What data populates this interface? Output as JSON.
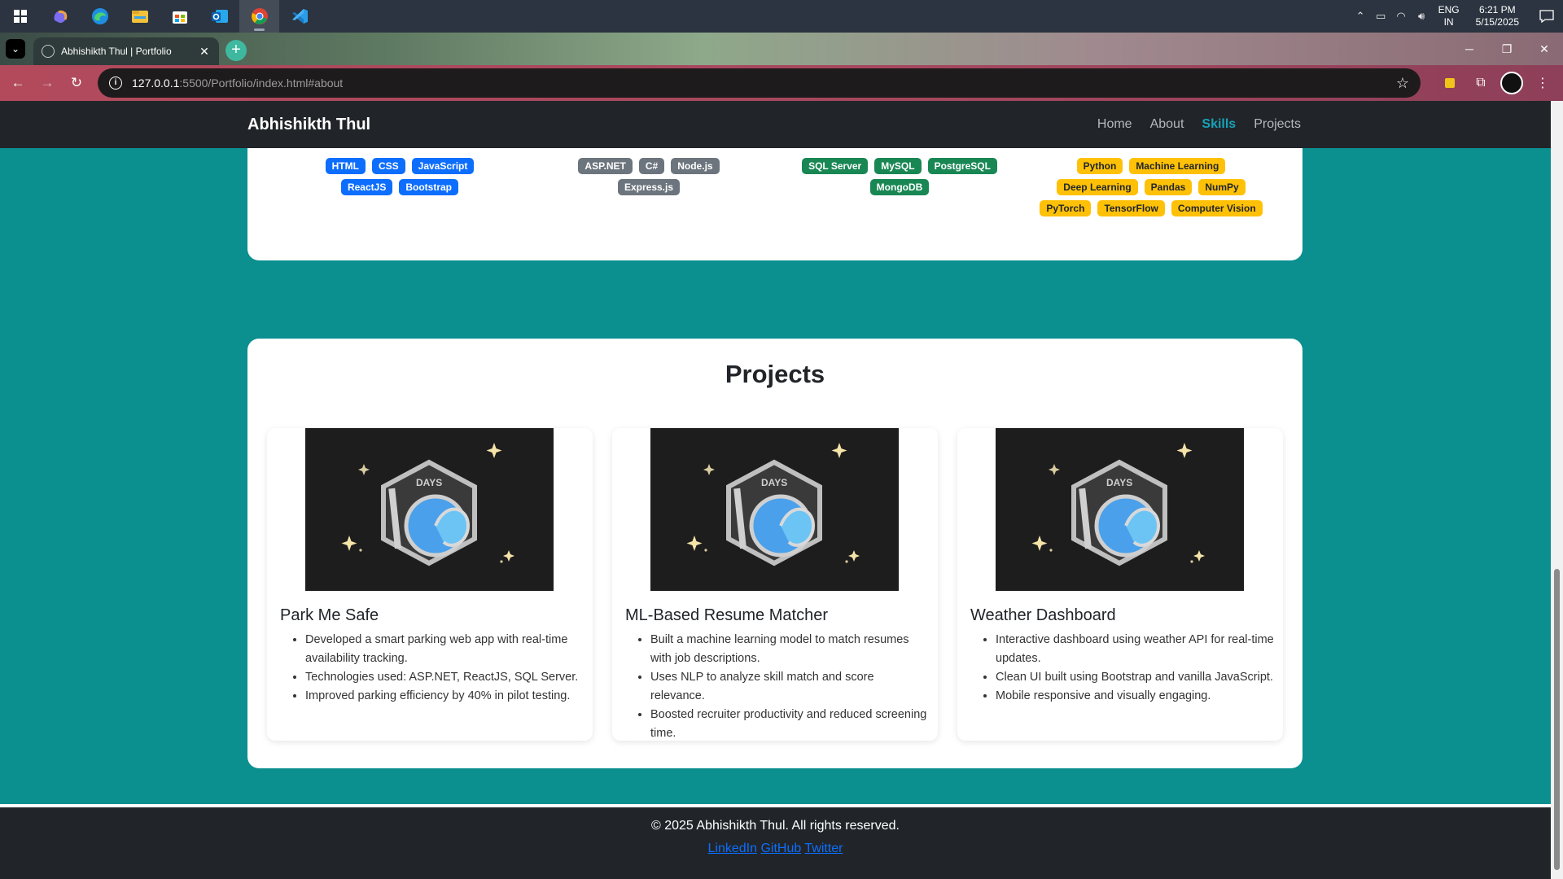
{
  "taskbar": {
    "apps": [
      "windows-start",
      "copilot",
      "edge",
      "file-explorer",
      "microsoft-store",
      "outlook",
      "chrome",
      "vscode"
    ],
    "tray": {
      "lang_line1": "ENG",
      "lang_line2": "IN",
      "time": "6:21 PM",
      "date": "5/15/2025"
    }
  },
  "browser": {
    "tab_title": "Abhishikth Thul | Portfolio",
    "url_host": "127.0.0.1",
    "url_path": ":5500/Portfolio/index.html#about"
  },
  "site": {
    "brand": "Abhishikth Thul",
    "nav": [
      {
        "label": "Home",
        "active": false
      },
      {
        "label": "About",
        "active": false
      },
      {
        "label": "Skills",
        "active": true
      },
      {
        "label": "Projects",
        "active": false
      }
    ],
    "skills": {
      "frontend": [
        "HTML",
        "CSS",
        "JavaScript",
        "ReactJS",
        "Bootstrap"
      ],
      "backend": [
        "ASP.NET",
        "C#",
        "Node.js",
        "Express.js"
      ],
      "database": [
        "SQL Server",
        "MySQL",
        "PostgreSQL",
        "MongoDB"
      ],
      "ai": [
        "Python",
        "Machine Learning",
        "Deep Learning",
        "Pandas",
        "NumPy",
        "PyTorch",
        "TensorFlow",
        "Computer Vision"
      ]
    },
    "projects_heading": "Projects",
    "projects": [
      {
        "title": "Park Me Safe",
        "image_text": "DAYS",
        "image_number": "1",
        "points": [
          "Developed a smart parking web app with real-time availability tracking.",
          "Technologies used: ASP.NET, ReactJS, SQL Server.",
          "Improved parking efficiency by 40% in pilot testing."
        ]
      },
      {
        "title": "ML-Based Resume Matcher",
        "image_text": "DAYS",
        "image_number": "1",
        "points": [
          "Built a machine learning model to match resumes with job descriptions.",
          "Uses NLP to analyze skill match and score relevance.",
          "Boosted recruiter productivity and reduced screening time."
        ]
      },
      {
        "title": "Weather Dashboard",
        "image_text": "DAYS",
        "image_number": "1",
        "points": [
          "Interactive dashboard using weather API for real-time updates.",
          "Clean UI built using Bootstrap and vanilla JavaScript.",
          "Mobile responsive and visually engaging."
        ]
      }
    ],
    "footer": {
      "copyright": "© 2025 Abhishikth Thul. All rights reserved.",
      "links": [
        "LinkedIn",
        "GitHub",
        "Twitter"
      ]
    }
  },
  "colors": {
    "page_bg": "#0b8f8f",
    "nav_active": "#17a2b8",
    "badge_frontend": "#0d6efd",
    "badge_backend": "#6c757d",
    "badge_database": "#198754",
    "badge_ai": "#ffc107"
  }
}
